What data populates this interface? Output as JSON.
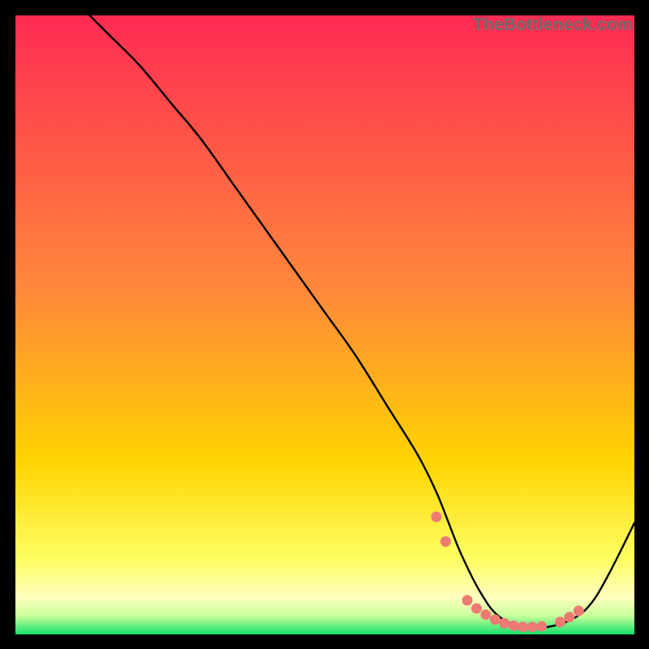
{
  "watermark": "TheBottleneck.com",
  "chart_data": {
    "type": "line",
    "title": "",
    "xlabel": "",
    "ylabel": "",
    "xlim": [
      0,
      100
    ],
    "ylim": [
      0,
      100
    ],
    "background_gradient": {
      "top_color": "#ff2b52",
      "mid_color": "#ffd400",
      "bottom_band_color": "#ffff9e",
      "bottom_edge_color": "#14e06b"
    },
    "series": [
      {
        "name": "bottleneck-curve",
        "type": "line",
        "color": "#000000",
        "x": [
          12,
          15,
          20,
          25,
          30,
          35,
          40,
          45,
          50,
          55,
          60,
          65,
          68,
          70,
          72,
          75,
          78,
          82,
          86,
          90,
          93,
          96,
          100
        ],
        "values": [
          100,
          97,
          92,
          86,
          80,
          73,
          66,
          59,
          52,
          45,
          37,
          29,
          23,
          18,
          13,
          7,
          3,
          1.2,
          1.2,
          2.5,
          5,
          10,
          18
        ]
      },
      {
        "name": "highlight-markers",
        "type": "scatter",
        "color": "#ee7a74",
        "x": [
          68,
          69.5,
          73,
          74.5,
          76,
          77.5,
          79,
          80.5,
          82,
          83.5,
          85,
          88,
          89.5,
          91
        ],
        "values": [
          19,
          15,
          5.5,
          4.2,
          3.2,
          2.4,
          1.8,
          1.4,
          1.2,
          1.2,
          1.3,
          2.0,
          2.8,
          3.8
        ]
      }
    ]
  }
}
